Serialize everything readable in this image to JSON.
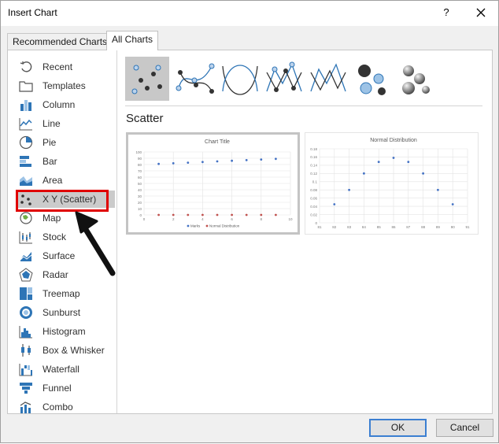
{
  "window": {
    "title": "Insert Chart",
    "help_glyph": "?"
  },
  "tabs": [
    {
      "label": "Recommended Charts"
    },
    {
      "label": "All Charts"
    }
  ],
  "sidebar": {
    "items": [
      {
        "label": "Recent",
        "icon": "recent-icon"
      },
      {
        "label": "Templates",
        "icon": "templates-icon"
      },
      {
        "label": "Column",
        "icon": "column-chart-icon"
      },
      {
        "label": "Line",
        "icon": "line-chart-icon"
      },
      {
        "label": "Pie",
        "icon": "pie-chart-icon"
      },
      {
        "label": "Bar",
        "icon": "bar-chart-icon"
      },
      {
        "label": "Area",
        "icon": "area-chart-icon"
      },
      {
        "label": "X Y (Scatter)",
        "icon": "scatter-chart-icon"
      },
      {
        "label": "Map",
        "icon": "map-chart-icon"
      },
      {
        "label": "Stock",
        "icon": "stock-chart-icon"
      },
      {
        "label": "Surface",
        "icon": "surface-chart-icon"
      },
      {
        "label": "Radar",
        "icon": "radar-chart-icon"
      },
      {
        "label": "Treemap",
        "icon": "treemap-chart-icon"
      },
      {
        "label": "Sunburst",
        "icon": "sunburst-chart-icon"
      },
      {
        "label": "Histogram",
        "icon": "histogram-chart-icon"
      },
      {
        "label": "Box & Whisker",
        "icon": "box-whisker-chart-icon"
      },
      {
        "label": "Waterfall",
        "icon": "waterfall-chart-icon"
      },
      {
        "label": "Funnel",
        "icon": "funnel-chart-icon"
      },
      {
        "label": "Combo",
        "icon": "combo-chart-icon"
      }
    ],
    "selected": "X Y (Scatter)"
  },
  "main": {
    "subtype_title": "Scatter",
    "subtypes": [
      "scatter-icon",
      "scatter-smooth-lines-markers-icon",
      "scatter-smooth-lines-icon",
      "scatter-straight-lines-markers-icon",
      "scatter-straight-lines-icon",
      "bubble-icon",
      "3d-bubble-icon"
    ]
  },
  "colors": {
    "accent": "#3c7fd1",
    "highlight": "#e00000",
    "series_blue": "#4472c4",
    "series_red": "#c0504d"
  },
  "chart_data": [
    {
      "type": "scatter",
      "title": "Chart Title",
      "x_ticks": [
        "0",
        "2",
        "4",
        "6",
        "8",
        "10"
      ],
      "y_ticks": [
        "0",
        "10",
        "20",
        "30",
        "40",
        "50",
        "60",
        "70",
        "80",
        "90",
        "100"
      ],
      "xlim": [
        0,
        10
      ],
      "ylim": [
        0,
        100
      ],
      "series": [
        {
          "name": "Marks",
          "x": [
            1,
            2,
            3,
            4,
            5,
            6,
            7,
            8,
            9
          ],
          "y": [
            81,
            82,
            83,
            84,
            85,
            86,
            87,
            88,
            89
          ]
        },
        {
          "name": "Normal Distribution",
          "x": [
            1,
            2,
            3,
            4,
            5,
            6,
            7,
            8,
            9
          ],
          "y": [
            0.05,
            0.08,
            0.12,
            0.14,
            0.16,
            0.14,
            0.12,
            0.08,
            0.05
          ]
        }
      ],
      "legend": "bottom",
      "grid": true
    },
    {
      "type": "scatter",
      "title": "Normal Distribution",
      "x_ticks": [
        "81",
        "82",
        "83",
        "84",
        "85",
        "86",
        "87",
        "88",
        "89",
        "90",
        "91"
      ],
      "y_ticks": [
        "0",
        "0.02",
        "0.04",
        "0.06",
        "0.08",
        "0.1",
        "0.12",
        "0.14",
        "0.16",
        "0.18"
      ],
      "xlim": [
        81,
        91
      ],
      "ylim": [
        0,
        0.18
      ],
      "series": [
        {
          "x": [
            82,
            83,
            84,
            85,
            86,
            87,
            88,
            89,
            90
          ],
          "y": [
            0.045,
            0.08,
            0.12,
            0.148,
            0.158,
            0.148,
            0.12,
            0.08,
            0.045
          ]
        }
      ],
      "legend": "none",
      "grid": true
    }
  ],
  "buttons": {
    "ok": "OK",
    "cancel": "Cancel"
  }
}
